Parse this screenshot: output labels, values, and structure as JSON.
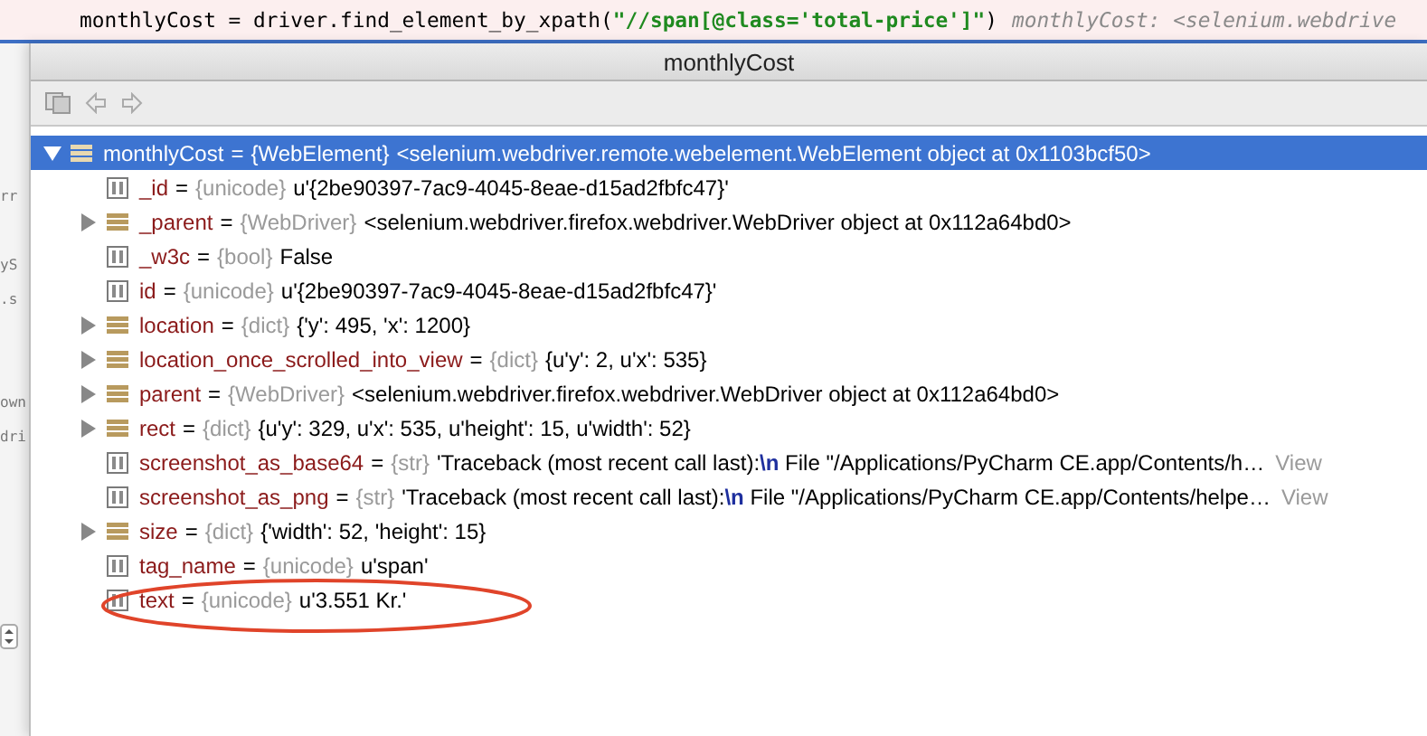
{
  "editor": {
    "code_line": [
      {
        "kind": "code",
        "text": "monthlyCost = driver.find_element_by_xpath("
      },
      {
        "kind": "string",
        "text": "\"//span[@class='total-price']\""
      },
      {
        "kind": "code",
        "text": ")"
      }
    ],
    "inline_hint": "monthlyCost: <selenium.webdrive",
    "gutter_fragments": [
      "rr",
      "yS",
      ".s",
      "own",
      "dri"
    ]
  },
  "popup": {
    "title": "monthlyCost",
    "tree": [
      {
        "kind": "object",
        "name": "monthlyCost",
        "operator": "=",
        "type": "{WebElement}",
        "value": "<selenium.webdriver.remote.webelement.WebElement object at 0x1103bcf50>",
        "expanded": true,
        "selected": true,
        "children": [
          {
            "kind": "primitive",
            "name": "_id",
            "operator": "=",
            "type": "{unicode}",
            "value": "u'{2be90397-7ac9-4045-8eae-d15ad2fbfc47}'",
            "selected": false
          },
          {
            "kind": "object",
            "name": "_parent",
            "operator": "=",
            "type": "{WebDriver}",
            "value": "<selenium.webdriver.firefox.webdriver.WebDriver object at 0x112a64bd0>",
            "expanded": false,
            "selected": false
          },
          {
            "kind": "primitive",
            "name": "_w3c",
            "operator": "=",
            "type": "{bool}",
            "value": "False",
            "selected": false
          },
          {
            "kind": "primitive",
            "name": "id",
            "operator": "=",
            "type": "{unicode}",
            "value": "u'{2be90397-7ac9-4045-8eae-d15ad2fbfc47}'",
            "selected": false
          },
          {
            "kind": "object",
            "name": "location",
            "operator": "=",
            "type": "{dict}",
            "value": "{'y': 495, 'x': 1200}",
            "expanded": false,
            "selected": false
          },
          {
            "kind": "object",
            "name": "location_once_scrolled_into_view",
            "operator": "=",
            "type": "{dict}",
            "value": "{u'y': 2, u'x': 535}",
            "expanded": false,
            "selected": false
          },
          {
            "kind": "object",
            "name": "parent",
            "operator": "=",
            "type": "{WebDriver}",
            "value": "<selenium.webdriver.firefox.webdriver.WebDriver object at 0x112a64bd0>",
            "expanded": false,
            "selected": false
          },
          {
            "kind": "object",
            "name": "rect",
            "operator": "=",
            "type": "{dict}",
            "value": "{u'y': 329, u'x': 535, u'height': 15, u'width': 52}",
            "expanded": false,
            "selected": false
          },
          {
            "kind": "primitive",
            "name": "screenshot_as_base64",
            "operator": "=",
            "type": "{str}",
            "value": "'Traceback (most recent call last):**\\n**  File \"/Applications/PyCharm CE.app/Contents/h…",
            "link": "View",
            "selected": false
          },
          {
            "kind": "primitive",
            "name": "screenshot_as_png",
            "operator": "=",
            "type": "{str}",
            "value": "'Traceback (most recent call last):**\\n**  File \"/Applications/PyCharm CE.app/Contents/helpe…",
            "link": "View",
            "selected": false
          },
          {
            "kind": "object",
            "name": "size",
            "operator": "=",
            "type": "{dict}",
            "value": "{'width': 52, 'height': 15}",
            "expanded": false,
            "selected": false
          },
          {
            "kind": "primitive",
            "name": "tag_name",
            "operator": "=",
            "type": "{unicode}",
            "value": "u'span'",
            "selected": false
          },
          {
            "kind": "primitive",
            "name": "text",
            "operator": "=",
            "type": "{unicode}",
            "value": "u'3.551 Kr.'",
            "circled": true,
            "selected": false
          }
        ]
      }
    ]
  }
}
